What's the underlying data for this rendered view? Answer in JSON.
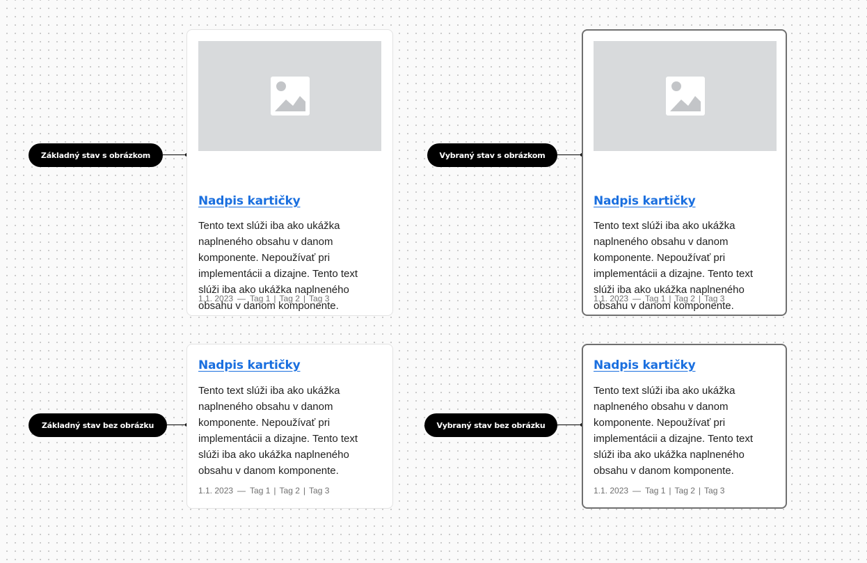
{
  "annotations": {
    "base_with_image": "Základný stav s obrázkom",
    "selected_with_image": "Vybraný stav s obrázkom",
    "base_without_image": "Základný stav bez obrázku",
    "selected_without_image": "Vybraný stav bez obrázku"
  },
  "card": {
    "title": "Nadpis kartičky",
    "body": "Tento text slúži iba ako ukážka naplneného obsahu v danom komponente. Nepoužívať pri implementácii a dizajne. Tento text slúži iba ako ukážka naplneného obsahu v danom komponente.",
    "date": "1.1. 2023",
    "date_separator": "—",
    "tag_separator": "|",
    "tags": [
      "Tag 1",
      "Tag 2",
      "Tag 3"
    ],
    "image_icon": "image-placeholder-icon"
  },
  "colors": {
    "title_link": "#1a6fdf",
    "selected_border": "#6f6f6f",
    "default_border": "#e3e3e3",
    "image_placeholder": "#d8dadc",
    "annotation_bg": "#000000"
  }
}
